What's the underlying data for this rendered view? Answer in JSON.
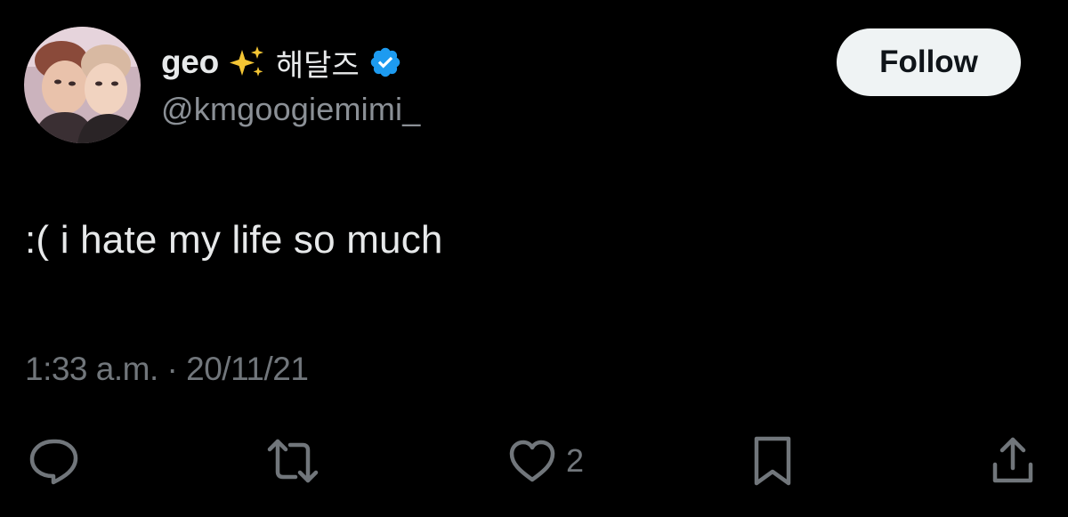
{
  "author": {
    "display_name": "geo",
    "emoji": "sparkles-emoji",
    "korean_name": "해달즈",
    "handle": "@kmgoogiemimi_",
    "verified": true
  },
  "follow_label": "Follow",
  "tweet": {
    "text": ":( i hate my life so much",
    "time": "1:33 a.m.",
    "separator": "·",
    "date": "20/11/21"
  },
  "actions": {
    "reply_count": "",
    "retweet_count": "",
    "like_count": "2",
    "bookmark_count": ""
  },
  "colors": {
    "background": "#000000",
    "text": "#e7e9ea",
    "secondary": "#71767b",
    "verified_blue": "#1d9bf0",
    "button_bg": "#eff3f4"
  }
}
